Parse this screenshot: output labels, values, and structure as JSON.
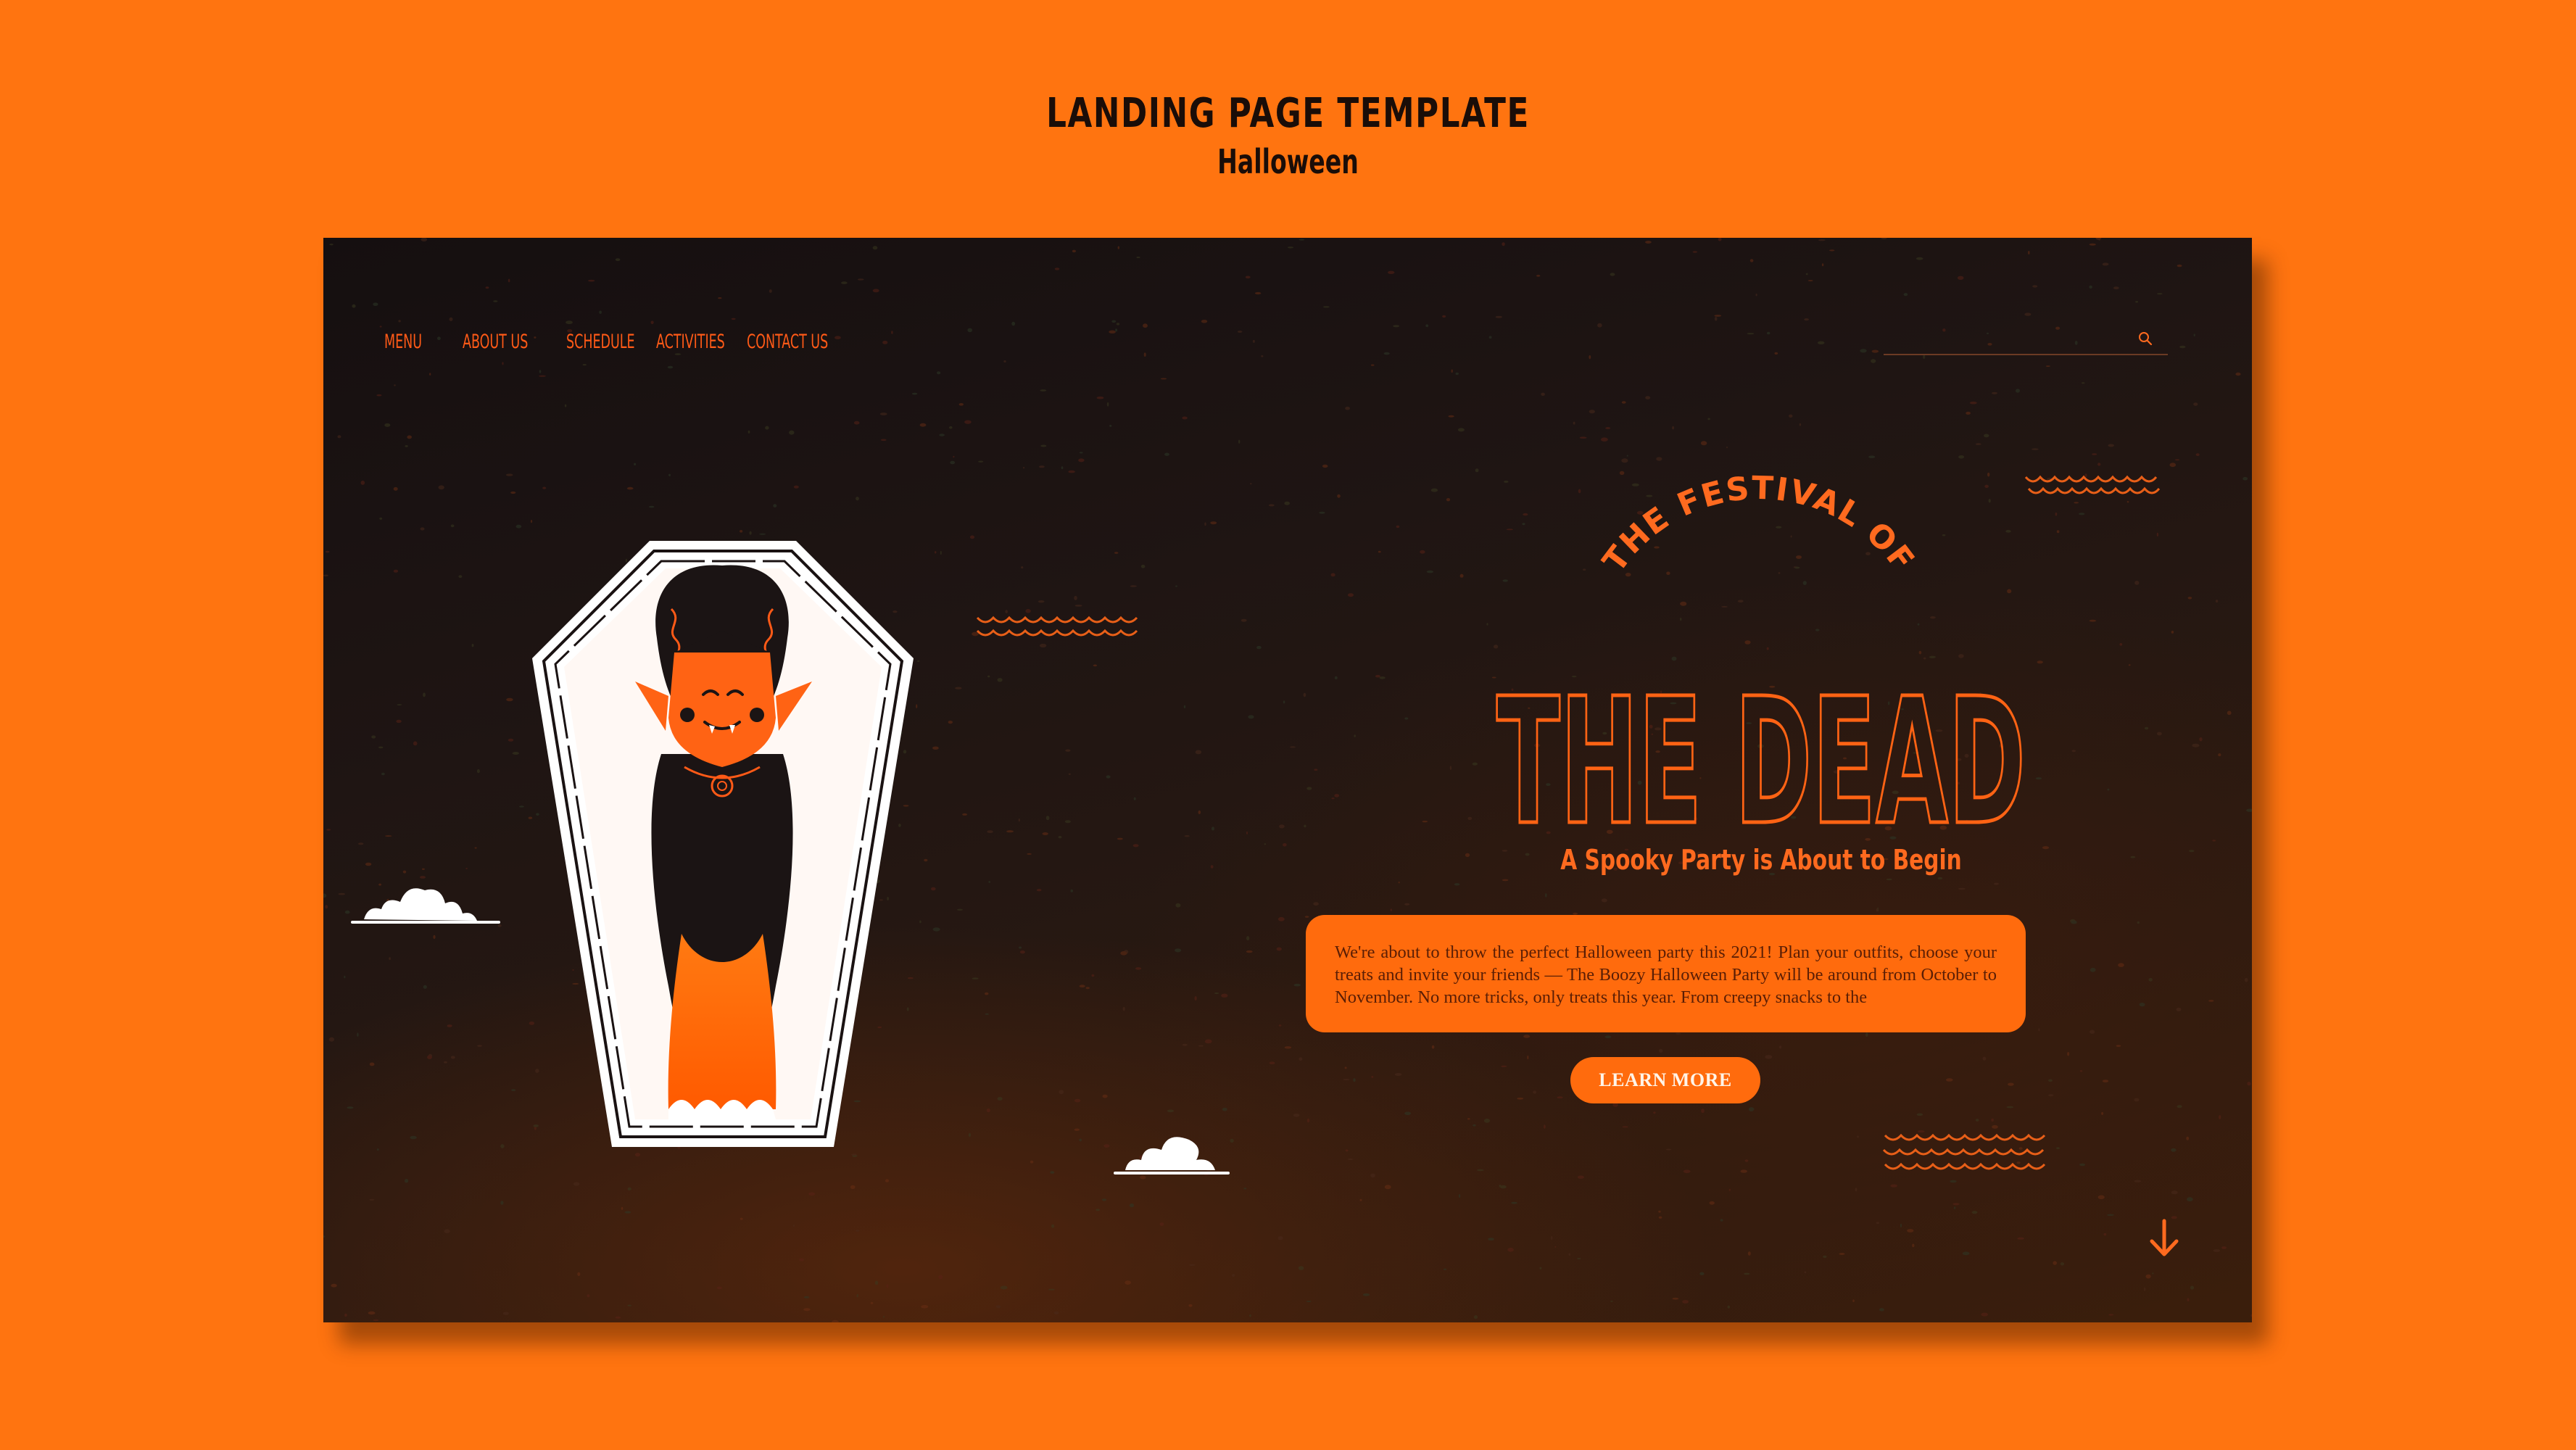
{
  "header": {
    "title": "LANDING PAGE TEMPLATE",
    "subtitle": "Halloween"
  },
  "nav": {
    "items": [
      {
        "label": "MENU"
      },
      {
        "label": "ABOUT US"
      },
      {
        "label": "SCHEDULE"
      },
      {
        "label": "ACTIVITIES"
      },
      {
        "label": "CONTACT US"
      }
    ]
  },
  "search": {
    "placeholder": "",
    "icon": "search-icon"
  },
  "hero": {
    "kicker": "THE FESTIVAL OF",
    "title": "THE DEAD",
    "tagline": "A Spooky Party is About to Begin",
    "description": "We're about to throw the perfect Halloween party this 2021! Plan your outfits, choose your treats and invite your friends — The Boozy Halloween Party will be around from October to November. No more tricks, only treats this year. From creepy snacks to the",
    "button_label": "LEARN MORE",
    "scroll_icon": "arrow-down-icon"
  },
  "colors": {
    "page_background": "#ff7410",
    "frame_dark": "#1f1513",
    "accent_orange": "#ff6b0d",
    "nav_text": "#ff5a17",
    "coffin_white": "#ffffff"
  },
  "illustration": {
    "subject": "vampire-in-coffin"
  }
}
